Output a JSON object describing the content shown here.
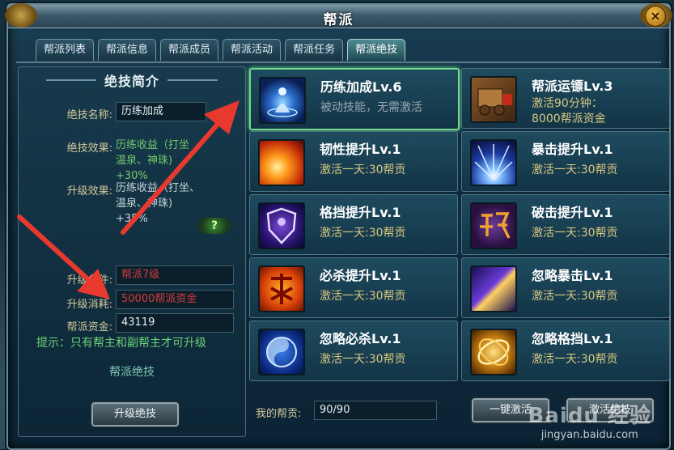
{
  "window": {
    "title": "帮派"
  },
  "tabs": [
    {
      "label": "帮派列表"
    },
    {
      "label": "帮派信息"
    },
    {
      "label": "帮派成员"
    },
    {
      "label": "帮派活动"
    },
    {
      "label": "帮派任务"
    },
    {
      "label": "帮派绝技",
      "active": true
    }
  ],
  "left": {
    "section_title": "绝技简介",
    "name_label": "绝技名称:",
    "name_value": "历练加成",
    "effect_label": "绝技效果:",
    "effect_lines": [
      "历练收益（打坐",
      "温泉、神珠)",
      "+30%"
    ],
    "upgrade_effect_label": "升级效果:",
    "upgrade_effect_lines": [
      "历练收益（打坐、",
      "温泉、神珠)",
      "+35%"
    ],
    "help_label": "?",
    "requirement_label": "升级条件:",
    "requirement_value": "帮派7级",
    "cost_label": "升级消耗:",
    "cost_value": "50000帮派资金",
    "funds_label": "帮派资金:",
    "funds_value": "43119",
    "hint": "提示：只有帮主和副帮主才可升级",
    "footer_title": "帮派绝技",
    "upgrade_button": "升级绝技"
  },
  "skills": [
    {
      "title": "历练加成Lv.6",
      "desc": "被动技能，无需激活",
      "icon": "meditation-icon",
      "selected": true
    },
    {
      "title": "帮派运镖Lv.3",
      "desc": "激活90分钟：",
      "desc2": "8000帮派资金",
      "icon": "escort-cart-icon"
    },
    {
      "title": "韧性提升Lv.1",
      "desc": "激活一天:30帮贡",
      "icon": "fire-icon"
    },
    {
      "title": "暴击提升Lv.1",
      "desc": "激活一天:30帮贡",
      "icon": "burst-icon"
    },
    {
      "title": "格挡提升Lv.1",
      "desc": "激活一天:30帮贡",
      "icon": "shield-icon"
    },
    {
      "title": "破击提升Lv.1",
      "desc": "激活一天:30帮贡",
      "icon": "break-rune-icon"
    },
    {
      "title": "必杀提升Lv.1",
      "desc": "激活一天:30帮贡",
      "icon": "kill-rune-icon"
    },
    {
      "title": "忽略暴击Lv.1",
      "desc": "激活一天:30帮贡",
      "icon": "slash-icon"
    },
    {
      "title": "忽略必杀Lv.1",
      "desc": "激活一天:30帮贡",
      "icon": "yin-yang-icon"
    },
    {
      "title": "忽略格挡Lv.1",
      "desc": "激活一天:30帮贡",
      "icon": "golden-ring-icon"
    }
  ],
  "contribution": {
    "label": "我的帮贡:",
    "value": "90/90"
  },
  "bottom_buttons": {
    "one_click": "一键激活",
    "activate": "激活绝技"
  },
  "watermark": {
    "logo": "Baidu 经验",
    "url": "jingyan.baidu.com"
  },
  "colors": {
    "selected_border": "#72d88c",
    "arrow": "#e8392e",
    "gold_text": "#d8c880",
    "red_text": "#d83a3a"
  }
}
